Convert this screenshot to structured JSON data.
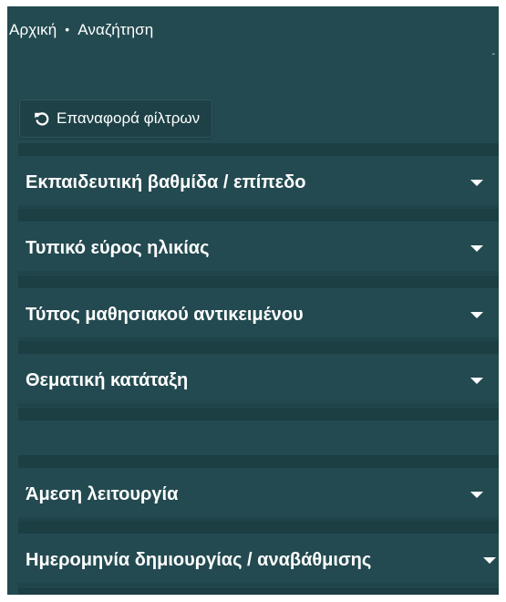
{
  "breadcrumb": {
    "home": "Αρχική",
    "separator": "•",
    "current": "Αναζήτηση"
  },
  "scroll_up_glyph": "ˆ",
  "reset_button": {
    "label": "Επαναφορά φίλτρων",
    "icon": "undo-icon"
  },
  "facets": [
    {
      "label": "Εκπαιδευτική βαθμίδα / επίπεδο",
      "icon": "caret-down-icon"
    },
    {
      "label": "Τυπικό εύρος ηλικίας",
      "icon": "caret-down-icon"
    },
    {
      "label": "Τύπος μαθησιακού αντικειμένου",
      "icon": "caret-down-icon"
    },
    {
      "label": "Θεματική κατάταξη",
      "icon": "caret-down-icon"
    },
    {
      "label": "Άμεση λειτουργία",
      "icon": "caret-down-icon"
    },
    {
      "label": "Ημερομηνία δημιουργίας / αναβάθμισης",
      "icon": "caret-down-icon"
    }
  ],
  "colors": {
    "panel_background": "#234a50",
    "band": "#1c3f44",
    "text": "#ffffff"
  }
}
